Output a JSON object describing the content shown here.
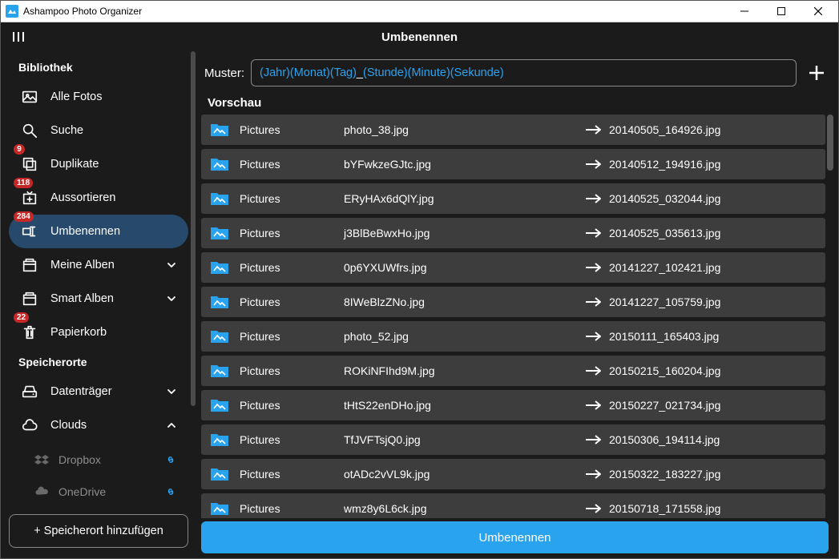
{
  "window": {
    "title": "Ashampoo Photo Organizer"
  },
  "header": {
    "page_title": "Umbenennen"
  },
  "sidebar": {
    "section_library": "Bibliothek",
    "section_locations": "Speicherorte",
    "items": [
      {
        "label": "Alle Fotos",
        "icon": "image",
        "badge": null,
        "expandable": false,
        "active": false
      },
      {
        "label": "Suche",
        "icon": "search",
        "badge": null,
        "expandable": false,
        "active": false
      },
      {
        "label": "Duplikate",
        "icon": "duplicate",
        "badge": "9",
        "expandable": false,
        "active": false
      },
      {
        "label": "Aussortieren",
        "icon": "sort-out",
        "badge": "118",
        "expandable": false,
        "active": false
      },
      {
        "label": "Umbenennen",
        "icon": "rename",
        "badge": "284",
        "expandable": false,
        "active": true
      },
      {
        "label": "Meine Alben",
        "icon": "album",
        "badge": null,
        "expandable": true,
        "active": false,
        "expanded": false
      },
      {
        "label": "Smart Alben",
        "icon": "album",
        "badge": null,
        "expandable": true,
        "active": false,
        "expanded": false
      },
      {
        "label": "Papierkorb",
        "icon": "trash",
        "badge": "22",
        "expandable": false,
        "active": false
      }
    ],
    "locations": [
      {
        "label": "Datenträger",
        "icon": "disk",
        "expandable": true,
        "expanded": false
      },
      {
        "label": "Clouds",
        "icon": "cloud",
        "expandable": true,
        "expanded": true
      }
    ],
    "clouds": [
      {
        "label": "Dropbox",
        "icon": "dropbox"
      },
      {
        "label": "OneDrive",
        "icon": "onedrive"
      }
    ],
    "add_location_label": "+ Speicherort hinzufügen"
  },
  "pattern": {
    "label": "Muster:",
    "tokens": [
      "(Jahr)",
      "(Monat)",
      "(Tag)",
      "_",
      "(Stunde)",
      "(Minute)",
      "(Sekunde)"
    ]
  },
  "preview": {
    "label": "Vorschau",
    "rows": [
      {
        "folder": "Pictures",
        "old": "photo_38.jpg",
        "new": "20140505_164926.jpg"
      },
      {
        "folder": "Pictures",
        "old": "bYFwkzeGJtc.jpg",
        "new": "20140512_194916.jpg"
      },
      {
        "folder": "Pictures",
        "old": "ERyHAx6dQlY.jpg",
        "new": "20140525_032044.jpg"
      },
      {
        "folder": "Pictures",
        "old": "j3BlBeBwxHo.jpg",
        "new": "20140525_035613.jpg"
      },
      {
        "folder": "Pictures",
        "old": "0p6YXUWfrs.jpg",
        "new": "20141227_102421.jpg"
      },
      {
        "folder": "Pictures",
        "old": "8IWeBlzZNo.jpg",
        "new": "20141227_105759.jpg"
      },
      {
        "folder": "Pictures",
        "old": "photo_52.jpg",
        "new": "20150111_165403.jpg"
      },
      {
        "folder": "Pictures",
        "old": "ROKiNFIhd9M.jpg",
        "new": "20150215_160204.jpg"
      },
      {
        "folder": "Pictures",
        "old": "tHtS22enDHo.jpg",
        "new": "20150227_021734.jpg"
      },
      {
        "folder": "Pictures",
        "old": "TfJVFTsjQ0.jpg",
        "new": "20150306_194114.jpg"
      },
      {
        "folder": "Pictures",
        "old": "otADc2vVL9k.jpg",
        "new": "20150322_183227.jpg"
      },
      {
        "folder": "Pictures",
        "old": "wmz8y6L6ck.jpg",
        "new": "20150718_171558.jpg"
      }
    ]
  },
  "actions": {
    "rename_button": "Umbenennen"
  }
}
